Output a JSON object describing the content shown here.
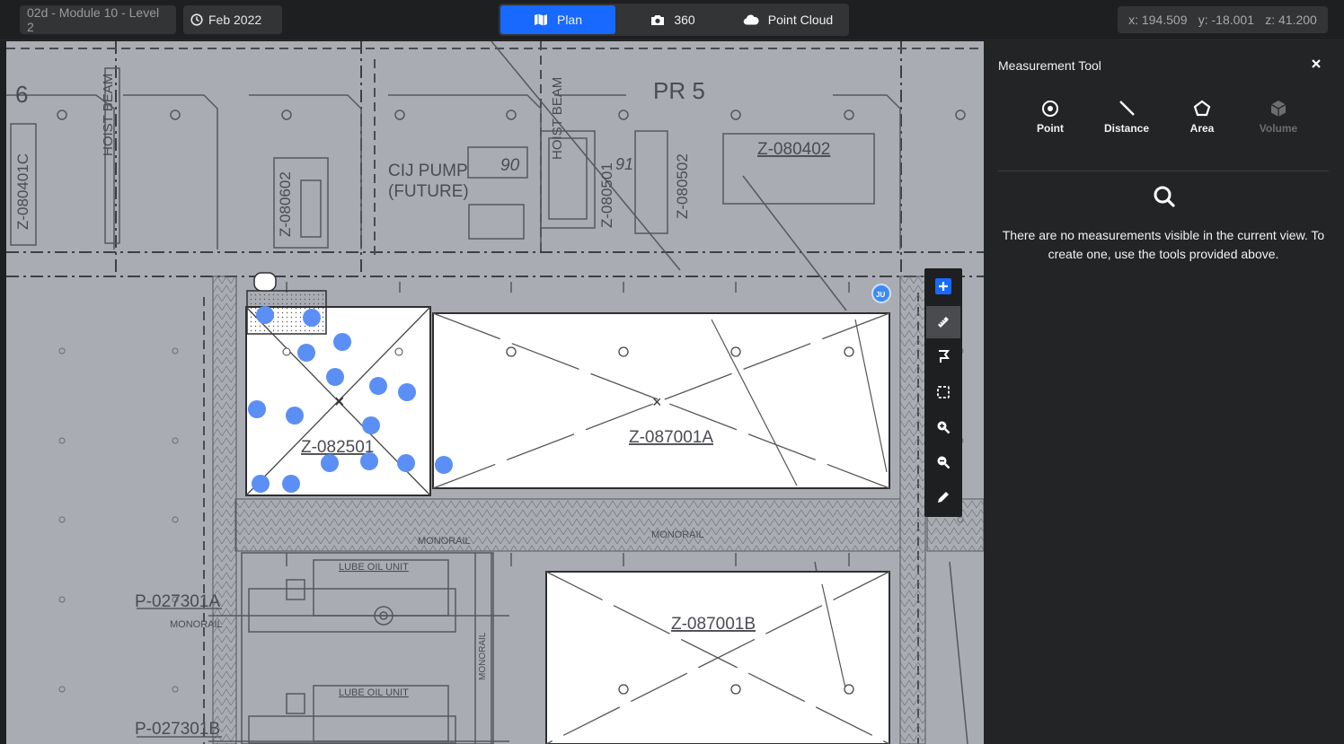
{
  "header": {
    "level_label": "02d - Module 10 - Level 2",
    "date_label": "Feb 2022",
    "modes": [
      {
        "label": "Plan",
        "icon": "map-icon",
        "active": true
      },
      {
        "label": "360",
        "icon": "camera-icon",
        "active": false
      },
      {
        "label": "Point Cloud",
        "icon": "cloud-icon",
        "active": false
      }
    ],
    "coords": {
      "x": "x: 194.509",
      "y": "y: -18.001",
      "z": "z: 41.200"
    }
  },
  "drawing": {
    "labels": {
      "pr5": "PR 5",
      "six": "6",
      "z080402": "Z-080402",
      "z080401c": "Z-080401C",
      "z080602": "Z-080602",
      "z080501": "Z-080501",
      "z080502": "Z-080502",
      "hoist_beam_1": "HOIST BEAM",
      "hoist_beam_2": "HOIST BEAM",
      "cij_pump": "CIJ PUMP",
      "future": "(FUTURE)",
      "n90": "90",
      "n91": "91",
      "z082501": "Z-082501",
      "z087001a": "Z-087001A",
      "z087001b": "Z-087001B",
      "monorail_1": "MONORAIL",
      "monorail_2": "MONORAIL",
      "monorail_3": "MONORAIL",
      "monorail_4": "MONORAIL",
      "lube_oil_1": "LUBE OIL UNIT",
      "lube_oil_2": "LUBE OIL UNIT",
      "p027301a": "P-027301A",
      "p027301b": "P-027301B",
      "marker_badge": "JU"
    }
  },
  "map_toolbar": {
    "items": [
      {
        "name": "add-button",
        "icon": "plus-icon",
        "active": false
      },
      {
        "name": "measure-button",
        "icon": "ruler-icon",
        "active": true
      },
      {
        "name": "annotate-button",
        "icon": "flag-icon",
        "active": false
      },
      {
        "name": "select-area-button",
        "icon": "dashed-rect-icon",
        "active": false
      },
      {
        "name": "zoom-in-button",
        "icon": "zoom-in-icon",
        "active": false
      },
      {
        "name": "zoom-out-button",
        "icon": "zoom-out-icon",
        "active": false
      },
      {
        "name": "edit-button",
        "icon": "pencil-icon",
        "active": false
      }
    ]
  },
  "measurement_panel": {
    "title": "Measurement Tool",
    "close_icon": "close-icon",
    "tools": [
      {
        "label": "Point",
        "icon": "target-icon",
        "enabled": true
      },
      {
        "label": "Distance",
        "icon": "line-icon",
        "enabled": true
      },
      {
        "label": "Area",
        "icon": "polygon-icon",
        "enabled": true
      },
      {
        "label": "Volume",
        "icon": "cube-icon",
        "enabled": false
      }
    ],
    "empty_icon": "search-icon",
    "empty_message": "There are no measurements visible in the current view. To create one, use the tools provided above."
  },
  "colors": {
    "accent": "#1769ff",
    "point_marker": "#5b8ff5",
    "drawing_bg": "#a9acb3",
    "panel_bg": "#232426"
  }
}
